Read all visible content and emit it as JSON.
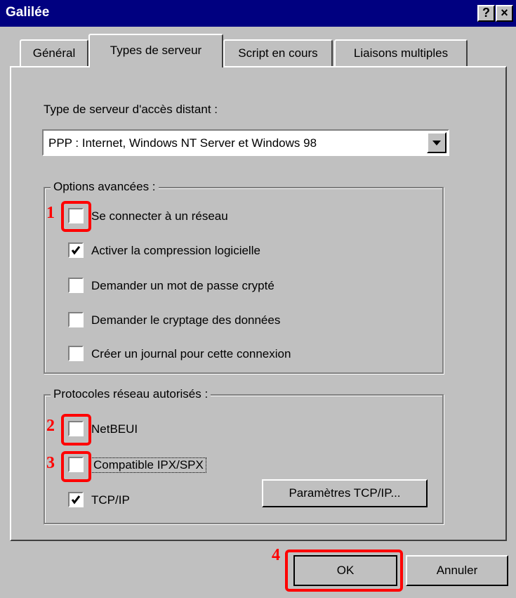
{
  "window": {
    "title": "Galilée",
    "help_glyph": "?",
    "close_glyph": "×"
  },
  "tabs": [
    {
      "label": "Général"
    },
    {
      "label": "Types de serveur"
    },
    {
      "label": "Script en cours"
    },
    {
      "label": "Liaisons multiples"
    }
  ],
  "server_type": {
    "label": "Type de serveur d'accès distant :",
    "selected": "PPP : Internet, Windows NT Server et Windows 98"
  },
  "advanced": {
    "legend": "Options avancées :",
    "options": [
      {
        "label": "Se connecter à un réseau",
        "checked": false
      },
      {
        "label": "Activer la compression logicielle",
        "checked": true
      },
      {
        "label": "Demander un mot de passe crypté",
        "checked": false
      },
      {
        "label": "Demander le cryptage des données",
        "checked": false
      },
      {
        "label": "Créer un journal pour cette connexion",
        "checked": false
      }
    ]
  },
  "protocols": {
    "legend": "Protocoles réseau autorisés :",
    "options": [
      {
        "label": "NetBEUI",
        "checked": false
      },
      {
        "label": "Compatible IPX/SPX",
        "checked": false
      },
      {
        "label": "TCP/IP",
        "checked": true
      }
    ],
    "tcp_settings_label": "Paramètres TCP/IP..."
  },
  "buttons": {
    "ok_label": "OK",
    "cancel_label": "Annuler"
  },
  "annotations": [
    "1",
    "2",
    "3",
    "4"
  ],
  "colors": {
    "titlebar": "#000080",
    "face": "#c0c0c0",
    "annotation": "#ff0000"
  }
}
